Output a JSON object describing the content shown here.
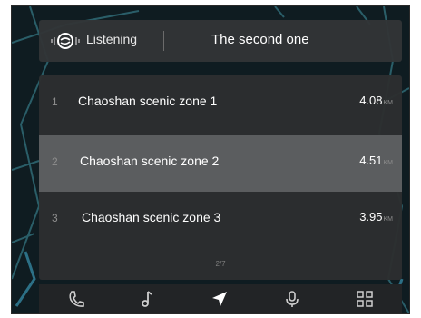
{
  "voice": {
    "status": "Listening",
    "reply": "The second one"
  },
  "results": [
    {
      "index": "1",
      "name": "Chaoshan scenic zone 1",
      "distance": "4.08",
      "unit": "KM",
      "selected": false
    },
    {
      "index": "2",
      "name": "Chaoshan scenic zone 2",
      "distance": "4.51",
      "unit": "KM",
      "selected": true
    },
    {
      "index": "3",
      "name": "Chaoshan scenic zone 3",
      "distance": "3.95",
      "unit": "KM",
      "selected": false
    }
  ],
  "pager": "2/7",
  "dock": [
    "phone-icon",
    "music-icon",
    "navigation-icon",
    "microphone-icon",
    "apps-grid-icon"
  ],
  "colors": {
    "accent": "#3fa9c9",
    "map_road": "#2f6a75",
    "selected_row": "#5b5d5f"
  }
}
